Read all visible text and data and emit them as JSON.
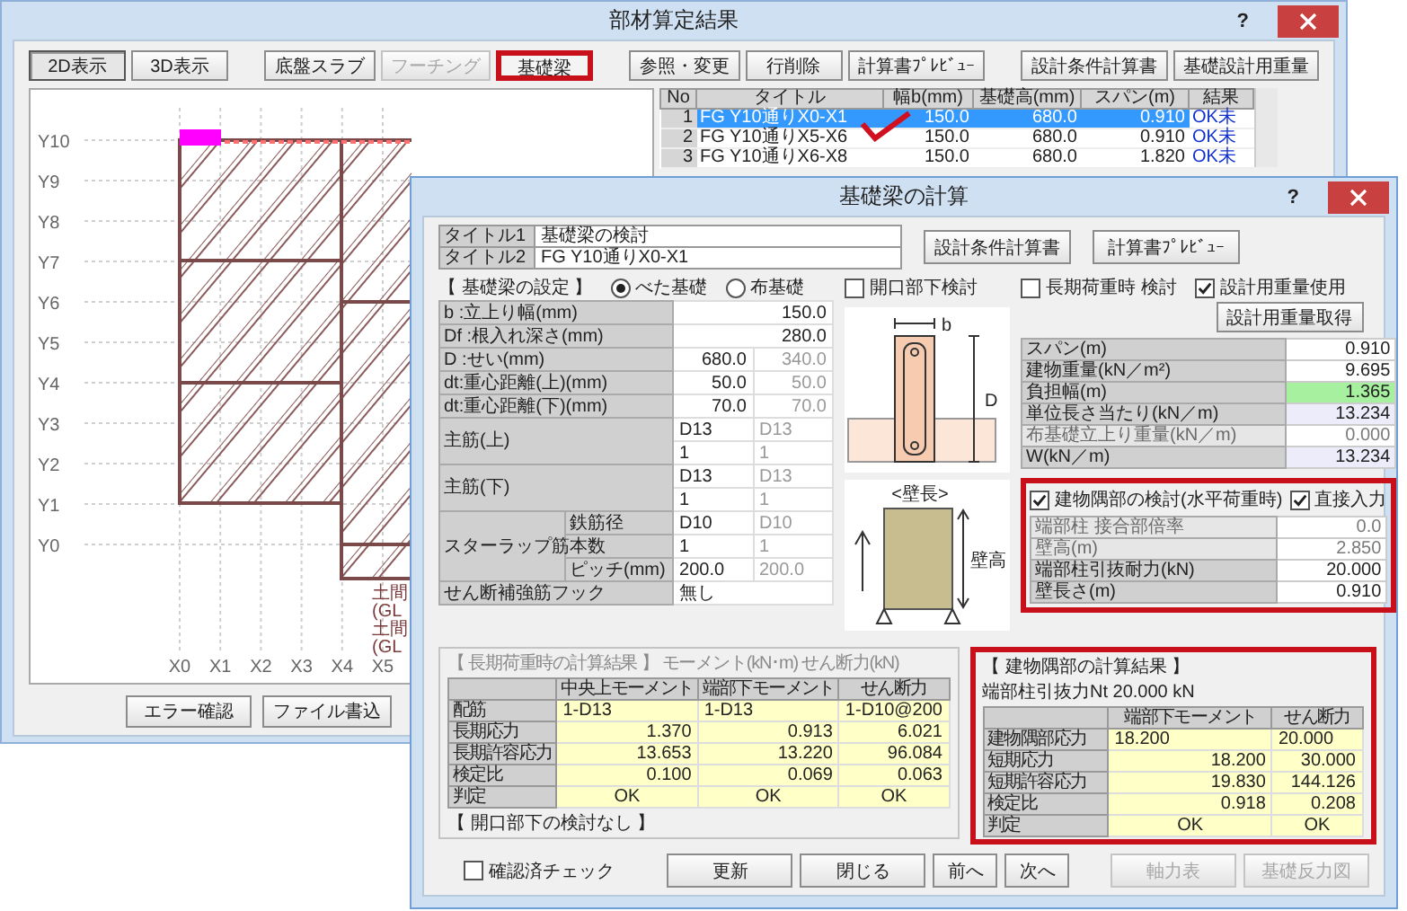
{
  "main_window": {
    "title": "部材算定結果",
    "help": "?",
    "view_tabs": [
      {
        "label": "2D表示",
        "selected": true
      },
      {
        "label": "3D表示",
        "selected": false
      }
    ],
    "member_types": [
      {
        "label": "底盤スラブ",
        "disabled": false,
        "highlighted": false
      },
      {
        "label": "フーチング",
        "disabled": true,
        "highlighted": false
      },
      {
        "label": "基礎梁",
        "disabled": false,
        "highlighted": true
      }
    ],
    "actions": [
      "参照・変更",
      "行削除",
      "計算書ﾌﾟﾚﾋﾞｭｰ"
    ],
    "reports": [
      "設計条件計算書",
      "基礎設計用重量"
    ],
    "plan": {
      "y_labels": [
        "Y10",
        "Y9",
        "Y8",
        "Y7",
        "Y6",
        "Y5",
        "Y4",
        "Y3",
        "Y2",
        "Y1",
        "Y0"
      ],
      "x_labels": [
        "X0",
        "X1",
        "X2",
        "X3",
        "X4",
        "X5"
      ],
      "notes": [
        "土間",
        "(GL",
        "土間",
        "(GL"
      ]
    },
    "table": {
      "columns": [
        "No",
        "タイトル",
        "幅b(mm)",
        "基礎高(mm)",
        "スパン(m)",
        "結果"
      ],
      "rows": [
        {
          "cells": [
            "1",
            "FG Y10通りX0-X1",
            "150.0",
            "680.0",
            "0.910",
            "OK未"
          ],
          "selected": true
        },
        {
          "cells": [
            "2",
            "FG Y10通りX5-X6",
            "150.0",
            "680.0",
            "0.910",
            "OK未"
          ],
          "selected": false
        },
        {
          "cells": [
            "3",
            "FG Y10通りX6-X8",
            "150.0",
            "680.0",
            "1.820",
            "OK未"
          ],
          "selected": false
        }
      ]
    },
    "bottom_buttons": [
      "エラー確認",
      "ファイル書込"
    ]
  },
  "dialog": {
    "title": "基礎梁の計算",
    "help": "?",
    "titles": [
      {
        "label": "タイトル1",
        "value": "基礎梁の検討"
      },
      {
        "label": "タイトル2",
        "value": "FG Y10通りX0-X1"
      }
    ],
    "top_buttons": [
      "設計条件計算書",
      "計算書ﾌﾟﾚﾋﾞｭｰ"
    ],
    "settings_heading": "【 基礎梁の設定 】",
    "foundation_types": [
      {
        "label": "べた基礎",
        "selected": true
      },
      {
        "label": "布基礎",
        "selected": false
      }
    ],
    "opening_check": {
      "label": "開口部下検討",
      "checked": false
    },
    "long_term_check": {
      "label": "長期荷重時 検討",
      "checked": false
    },
    "design_weight_check": {
      "label": "設計用重量使用",
      "checked": true
    },
    "get_weight_button": "設計用重量取得",
    "settings": [
      {
        "kind": "single",
        "label": "b :立上り幅(mm)",
        "value": "150.0"
      },
      {
        "kind": "single",
        "label": "Df :根入れ深さ(mm)",
        "value": "280.0"
      },
      {
        "kind": "pair",
        "label": "D :せい(mm)",
        "value": "680.0",
        "sub_value": "340.0"
      },
      {
        "kind": "pair",
        "label": "dt:重心距離(上)(mm)",
        "value": "50.0",
        "sub_value": "50.0"
      },
      {
        "kind": "pair",
        "label": "dt:重心距離(下)(mm)",
        "value": "70.0",
        "sub_value": "70.0"
      },
      {
        "kind": "rebar",
        "label": "主筋(上)",
        "values": [
          [
            "D13",
            "D13"
          ],
          [
            "1",
            "1"
          ]
        ]
      },
      {
        "kind": "rebar",
        "label": "主筋(下)",
        "values": [
          [
            "D13",
            "D13"
          ],
          [
            "1",
            "1"
          ]
        ]
      },
      {
        "kind": "stirrup",
        "label": "スターラップ筋",
        "items": [
          {
            "label": "鉄筋径",
            "value": "D10",
            "sub_value": "D10"
          },
          {
            "label": "本数",
            "value": "1",
            "sub_value": "1"
          },
          {
            "label": "ピッチ(mm)",
            "value": "200.0",
            "sub_value": "200.0"
          }
        ]
      },
      {
        "kind": "text",
        "label": "せん断補強筋フック",
        "value": "無し"
      }
    ],
    "section_drawing": {
      "width_mark": "b",
      "height_mark": "D"
    },
    "wall_drawing": {
      "title": "<壁長>",
      "height_label": "壁高"
    },
    "load_table": [
      {
        "kind": "plain",
        "label": "スパン(m)",
        "value": "0.910"
      },
      {
        "kind": "plain",
        "label": "建物重量(kN／m²)",
        "value": "9.695"
      },
      {
        "kind": "input",
        "label": "負担幅(m)",
        "value": "1.365"
      },
      {
        "kind": "computed",
        "label": "単位長さ当たり(kN／m)",
        "value": "13.234"
      },
      {
        "kind": "disabled",
        "label": "布基礎立上り重量(kN／m)",
        "value": "0.000"
      },
      {
        "kind": "computed",
        "label": "W(kN／m)",
        "value": "13.234"
      }
    ],
    "corner_check": {
      "label": "建物隅部の検討(水平荷重時)",
      "checked": true,
      "highlighted": true
    },
    "direct_input": {
      "label": "直接入力",
      "checked": true
    },
    "corner_table": [
      {
        "label": "端部柱 接合部倍率",
        "value": "0.0",
        "disabled": true
      },
      {
        "label": "壁高(m)",
        "value": "2.850",
        "disabled": true
      },
      {
        "label": "端部柱引抜耐力(kN)",
        "value": "20.000",
        "disabled": false
      },
      {
        "label": "壁長さ(m)",
        "value": "0.910",
        "disabled": false
      }
    ],
    "long_term_results": {
      "heading": "【 長期荷重時の計算結果 】 モーメント(kN･m) せん断力(kN)",
      "disabled": true,
      "columns": [
        "中央上モーメント",
        "端部下モーメント",
        "せん断力"
      ],
      "rows": [
        {
          "label": "配筋",
          "cells": [
            "1-D13",
            "1-D13",
            "1-D10@200"
          ]
        },
        {
          "label": "長期応力",
          "cells": [
            "1.370",
            "0.913",
            "6.021"
          ]
        },
        {
          "label": "長期許容応力",
          "cells": [
            "13.653",
            "13.220",
            "96.084"
          ]
        },
        {
          "label": "検定比",
          "cells": [
            "0.100",
            "0.069",
            "0.063"
          ]
        },
        {
          "label": "判定",
          "cells": [
            "OK",
            "OK",
            "OK"
          ]
        }
      ],
      "note": "【 開口部下の検討なし 】"
    },
    "corner_results": {
      "heading": "【 建物隅部の計算結果 】",
      "pull_force": "端部柱引抜力Nt 20.000 kN",
      "highlighted": true,
      "columns": [
        "端部下モーメント",
        "せん断力"
      ],
      "rows": [
        {
          "label": "建物隅部応力",
          "cells": [
            "18.200",
            "20.000"
          ]
        },
        {
          "label": "短期応力",
          "cells": [
            "18.200",
            "30.000"
          ]
        },
        {
          "label": "短期許容応力",
          "cells": [
            "19.830",
            "144.126"
          ]
        },
        {
          "label": "検定比",
          "cells": [
            "0.918",
            "0.208"
          ]
        },
        {
          "label": "判定",
          "cells": [
            "OK",
            "OK"
          ]
        }
      ]
    },
    "confirm_check": {
      "label": "確認済チェック",
      "checked": false
    },
    "footer_buttons": [
      {
        "label": "更新",
        "disabled": false
      },
      {
        "label": "閉じる",
        "disabled": false
      },
      {
        "label": "前へ",
        "disabled": false
      },
      {
        "label": "次へ",
        "disabled": false
      },
      {
        "label": "軸力表",
        "disabled": true
      },
      {
        "label": "基礎反力図",
        "disabled": true
      }
    ]
  }
}
